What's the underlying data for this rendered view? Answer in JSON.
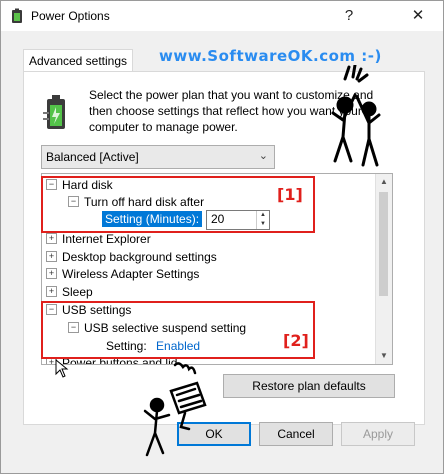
{
  "window": {
    "title": "Power Options",
    "help_glyph": "?",
    "close_glyph": "✕"
  },
  "tabs": [
    {
      "label": "Advanced settings"
    }
  ],
  "watermark": "www.SoftwareOK.com :-)",
  "description": "Select the power plan that you want to customize and then choose settings that reflect how you want your computer to manage power.",
  "plan_select": {
    "value": "Balanced [Active]"
  },
  "tree": {
    "hard_disk": {
      "label": "Hard disk",
      "expander": "−"
    },
    "turn_off_hard_disk": {
      "label": "Turn off hard disk after",
      "expander": "−"
    },
    "setting_minutes": {
      "label": "Setting (Minutes):",
      "value": "20"
    },
    "collapsed": [
      {
        "label": "Internet Explorer",
        "expander": "+"
      },
      {
        "label": "Desktop background settings",
        "expander": "+"
      },
      {
        "label": "Wireless Adapter Settings",
        "expander": "+"
      },
      {
        "label": "Sleep",
        "expander": "+"
      }
    ],
    "usb_settings": {
      "label": "USB settings",
      "expander": "−"
    },
    "usb_selective": {
      "label": "USB selective suspend setting",
      "expander": "−"
    },
    "usb_setting": {
      "label": "Setting:",
      "value": "Enabled"
    },
    "power_buttons": {
      "label": "Power buttons and lid",
      "expander": "+"
    }
  },
  "annotations": {
    "one": "[1]",
    "two": "[2]"
  },
  "buttons": {
    "restore": "Restore plan defaults",
    "ok": "OK",
    "cancel": "Cancel",
    "apply": "Apply"
  },
  "colors": {
    "accent": "#0078d7",
    "annotation": "#e0201c",
    "watermark": "#2a8cf0",
    "link": "#0066cc"
  },
  "icons": [
    "power-options-icon",
    "help-icon",
    "close-icon",
    "battery-plug-icon",
    "chevron-down-icon",
    "mouse-cursor-icon"
  ]
}
